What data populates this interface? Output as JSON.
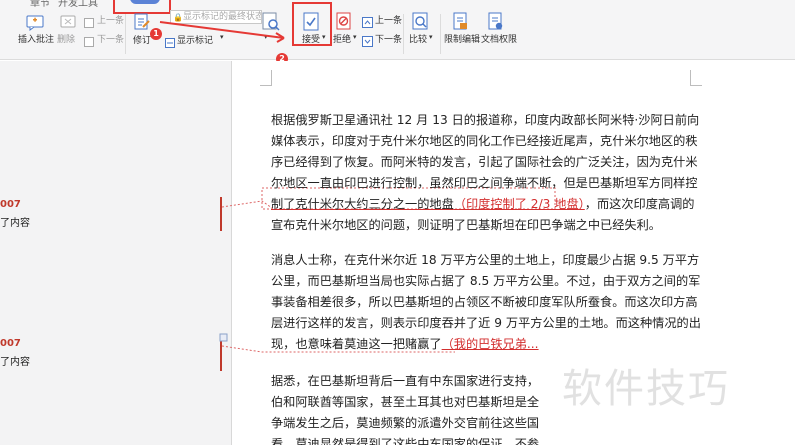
{
  "toolbar": {
    "tabs": [
      "章节",
      "开发工具",
      "审阅"
    ],
    "track_placeholder": "显示标记的最终状态",
    "insert_comment": "插入批注",
    "delete": "删除",
    "prev_top": "上一条",
    "next_top": "下一条",
    "track_changes": "修订",
    "show_markup": "显示标记",
    "accept": "接受",
    "reject": "拒绝",
    "prev": "上一条",
    "next": "下一条",
    "compare": "比较",
    "restrict_edit": "限制编辑",
    "doc_permission": "文档权限",
    "badge1": "1",
    "badge2": "2",
    "colors": {
      "highlight_box": "#e53935",
      "active_tab": "#5b82d6"
    }
  },
  "comments": [
    {
      "num": "007",
      "text": "了内容"
    },
    {
      "num": "007",
      "text": "了内容"
    }
  ],
  "doc": {
    "p1": [
      "根据俄罗斯卫星通讯社 12 月 13 日的报道称，印度内政部长阿米特·沙阿日前向",
      "媒体表示，印度对于克什米尔地区的同化工作已经接近尾声，克什米尔地区的秩",
      "序已经得到了恢复。而阿米特的发言，引起了国际社会的广泛关注，因为克什米",
      "尔地区一直由印巴进行控制，虽然印巴之间争端不断，但是巴基斯坦军方同样控"
    ],
    "p1_l5_pre": "制了克什米尔大约三分之一的地盘",
    "p1_l5_ins": "（印度控制了 2/3 地盘）",
    "p1_l5_post": "，而这次印度高调的",
    "p1_l6": "宣布克什米尔地区的问题，则证明了巴基斯坦在印巴争端之中已经失利。",
    "p2": [
      "消息人士称，在克什米尔近 18 万平方公里的土地上，印度最少占据 9.5 万平方",
      "公里，而巴基斯坦当局也实际占据了 8.5 万平方公里。不过，由于双方之间的军",
      "事装备相差很多，所以巴基斯坦的占领区不断被印度军队所蚕食。而这次印方高",
      "层进行这样的发言，则表示印度吞并了近 9 万平方公里的土地。而这种情况的出"
    ],
    "p2_l5_pre": "现，也意味着莫迪这一把赌赢了",
    "p2_l5_ins": "（我的巴铁兄弟...",
    "p3": [
      "据悉，在巴基斯坦背后一直有中东国家进行支持，",
      "伯和阿联酋等国家，甚至土耳其也对巴基斯坦是全",
      "争端发生之后，莫迪频繁的派遣外交官前往这些国",
      "看，莫迪显然是得到了这些中东国家的保证，不参"
    ]
  },
  "watermark": "软件技巧"
}
